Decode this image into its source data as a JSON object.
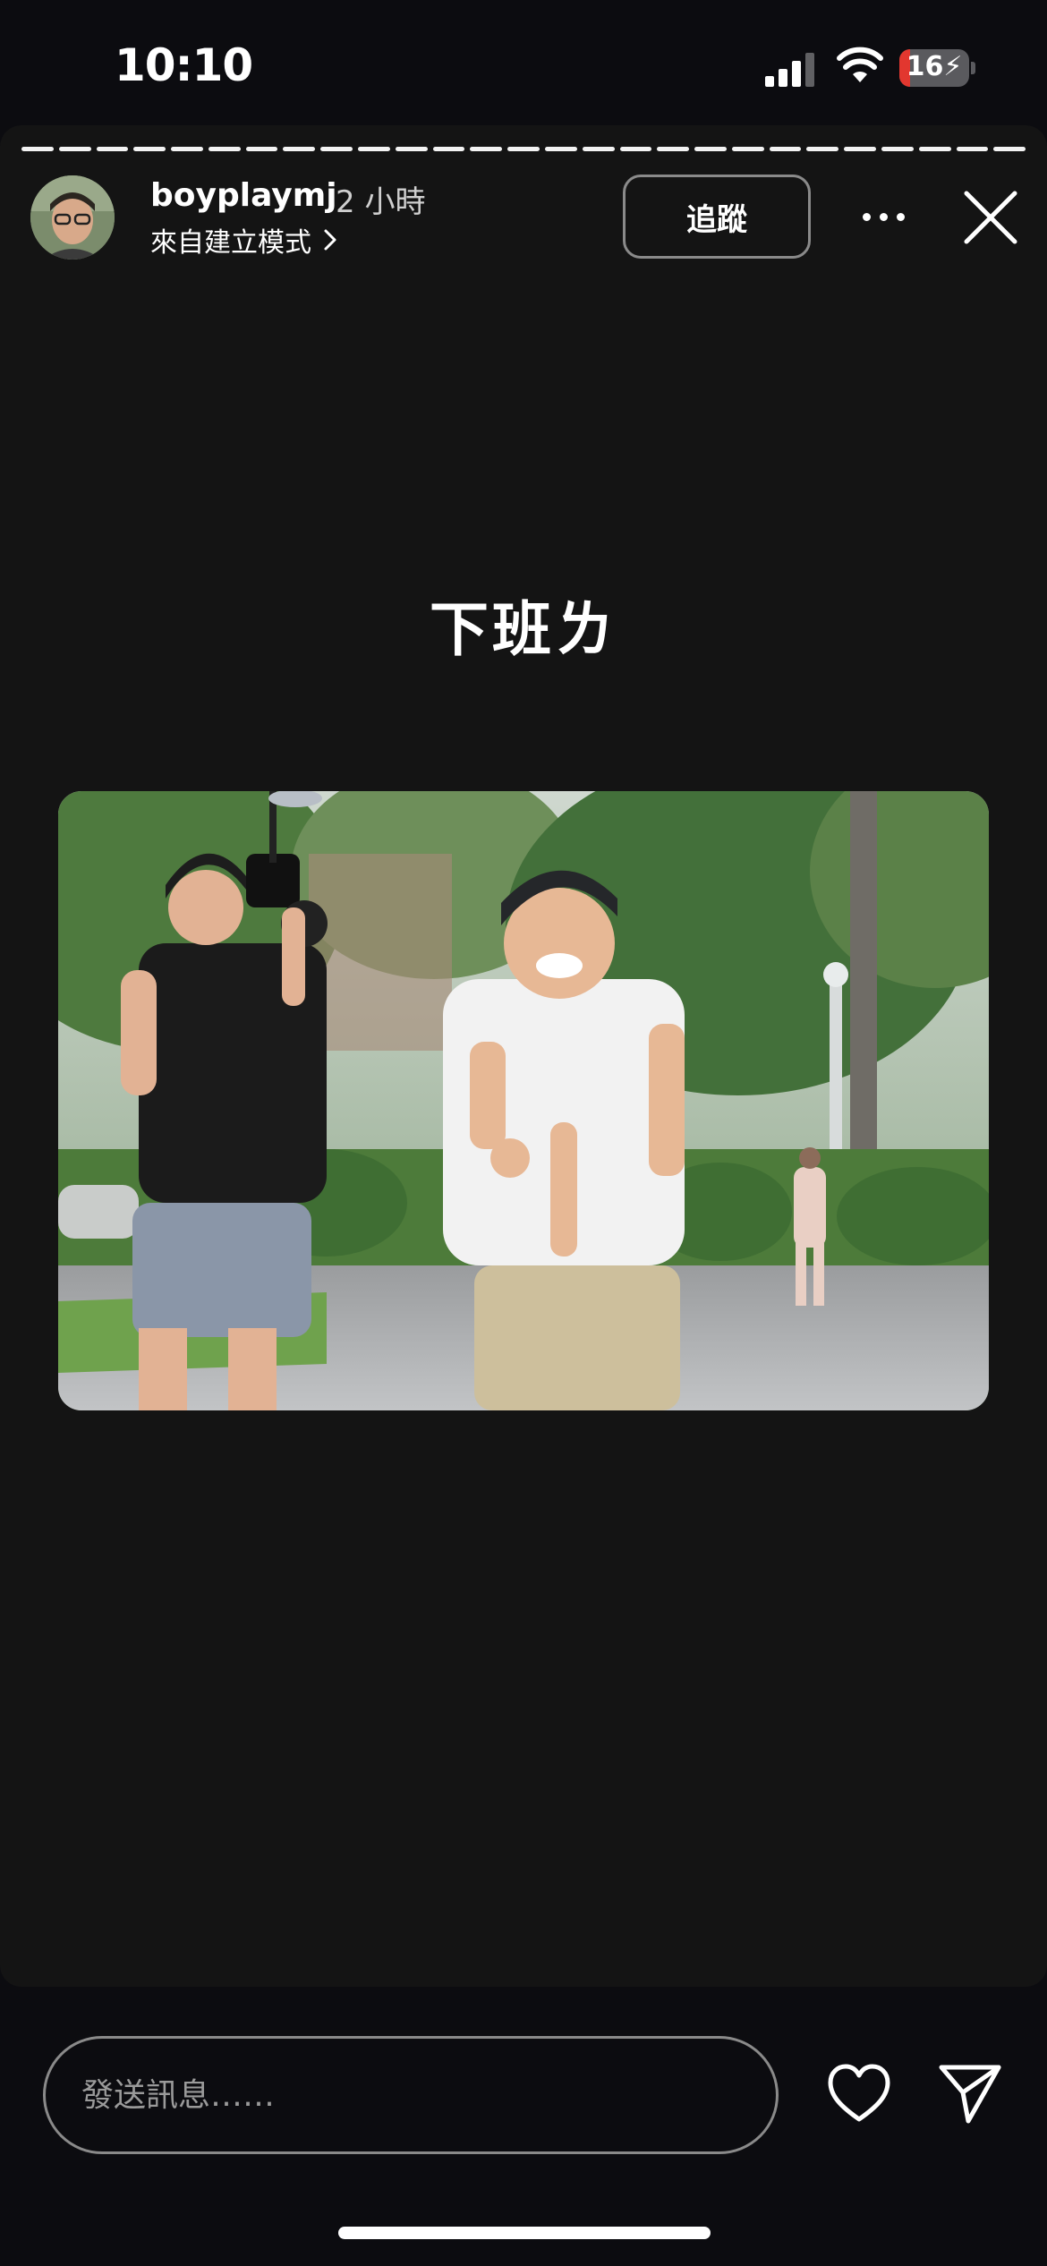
{
  "status_bar": {
    "time": "10:10",
    "battery_level": "16",
    "battery_percent": 16,
    "icons": [
      "cellular-signal-icon",
      "wifi-icon",
      "battery-charging-icon"
    ]
  },
  "story": {
    "segments_total": 27,
    "segments_done": 27,
    "username": "boyplaymj",
    "post_time": "2 小時",
    "source_label": "來自建立模式",
    "follow_label": "追蹤",
    "caption": "下班ㄌ",
    "icons": [
      "chevron-right-icon",
      "more-icon",
      "close-icon"
    ]
  },
  "reply_bar": {
    "placeholder": "發送訊息……",
    "icons": [
      "heart-icon",
      "send-icon"
    ]
  },
  "colors": {
    "background": "#0c0c10",
    "story_background": "#141414",
    "battery_low": "#e2372f",
    "outline": "#8a8a8a"
  }
}
